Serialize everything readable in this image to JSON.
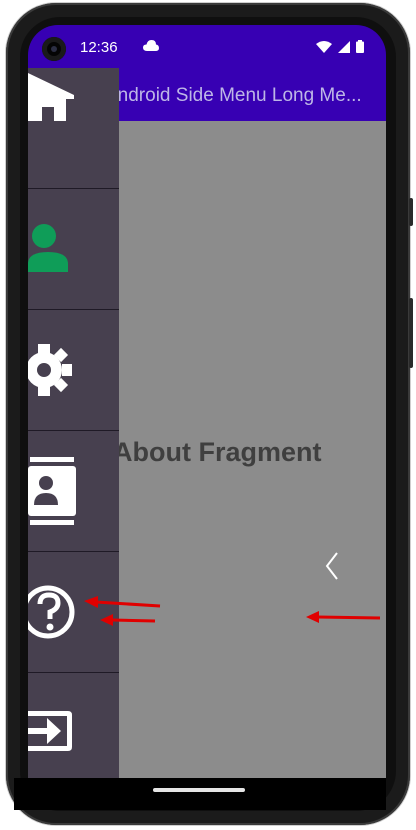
{
  "status_bar": {
    "time": "12:36"
  },
  "app_bar": {
    "title": "Android Side Menu Long Me..."
  },
  "content": {
    "label": "About Fragment"
  },
  "drawer": {
    "items": [
      {
        "icon": "home-icon"
      },
      {
        "icon": "person-icon"
      },
      {
        "icon": "gear-icon"
      },
      {
        "icon": "contact-card-icon"
      },
      {
        "icon": "help-icon"
      },
      {
        "icon": "logout-icon"
      }
    ]
  },
  "colors": {
    "status_bar": "#3700b3",
    "app_bar": "#3700b3",
    "drawer": "#47404f",
    "content_background": "#8c8c8c",
    "person_icon": "#0f9d58",
    "annotation_arrow": "#e00000"
  }
}
